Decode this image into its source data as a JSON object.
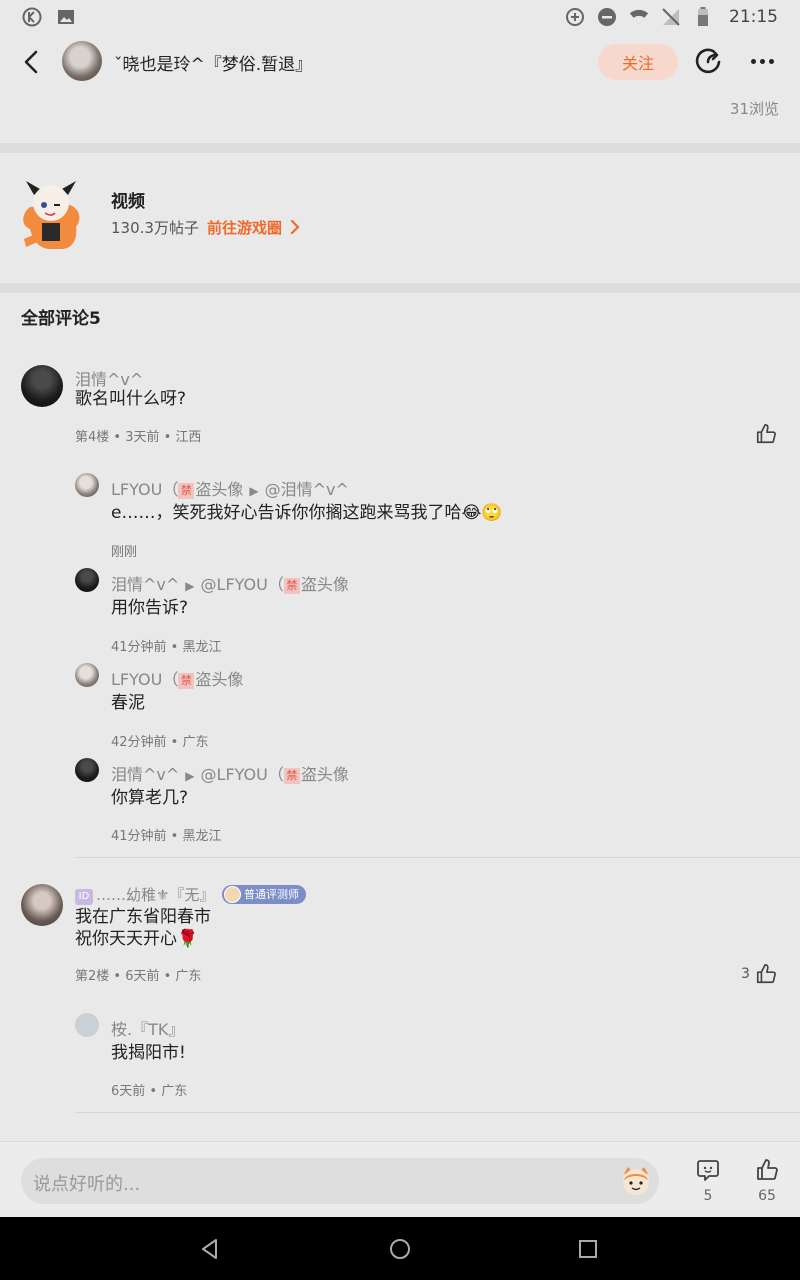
{
  "status_bar": {
    "time": "21:15"
  },
  "header": {
    "author_name": "ˇ晓也是玲^『梦俗.暂退』",
    "follow_label": "关注"
  },
  "post": {
    "views": "31浏览"
  },
  "circle": {
    "name": "视频",
    "posts": "130.3万帖子",
    "link_label": "前往游戏圈"
  },
  "comments": {
    "title": "全部评论5",
    "items": [
      {
        "name": "泪情^v^",
        "text": "歌名叫什么呀?",
        "meta": "第4楼 • 3天前 • 江西",
        "replies": [
          {
            "name": "LFYOU（",
            "ban": "禁",
            "name_suffix": "盗头像",
            "arrow": "▶",
            "to": "@泪情^v^",
            "text": "e……，笑死我好心告诉你你搁这跑来骂我了哈😂🙄",
            "meta": "刚刚"
          },
          {
            "name": "泪情^v^",
            "arrow": "▶",
            "to": "@LFYOU（",
            "ban": "禁",
            "to_suffix": "盗头像",
            "text": "用你告诉?",
            "meta": "41分钟前 • 黑龙江"
          },
          {
            "name": "LFYOU（",
            "ban": "禁",
            "name_suffix": "盗头像",
            "text": "春泥",
            "meta": "42分钟前 • 广东"
          },
          {
            "name": "泪情^v^",
            "arrow": "▶",
            "to": "@LFYOU（",
            "ban": "禁",
            "to_suffix": "盗头像",
            "text": "你算老几?",
            "meta": "41分钟前 • 黑龙江"
          }
        ]
      },
      {
        "id_mark": "ID",
        "name": "……幼稚⚜『无』",
        "badge": "普通评测师",
        "text_line1": "我在广东省阳春市",
        "text_line2": "祝你天天开心🌹",
        "meta": "第2楼 • 6天前 • 广东",
        "likes": "3",
        "replies": [
          {
            "name": "桉.『TK』",
            "text": "我揭阳市!",
            "meta": "6天前 • 广东"
          }
        ]
      }
    ]
  },
  "bottom_bar": {
    "input_placeholder": "说点好听的...",
    "comment_count": "5",
    "like_count": "65"
  },
  "colors": {
    "accent": "#f06a2a",
    "follow_bg": "#f6d8cc",
    "background": "#e9e9e9"
  }
}
